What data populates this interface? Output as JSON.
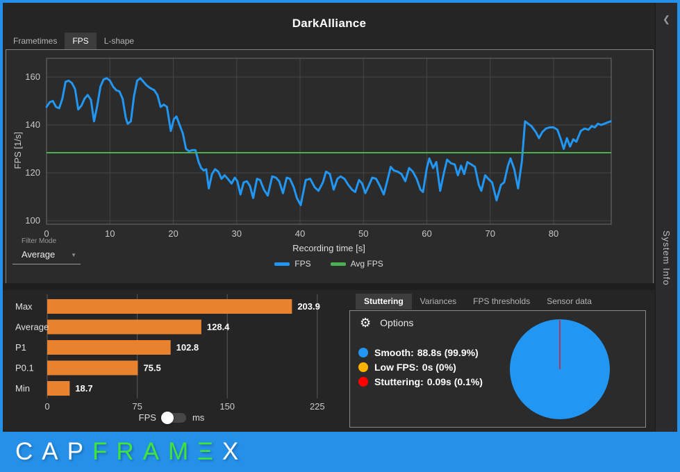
{
  "window": {
    "title": "DarkAlliance"
  },
  "icons": {
    "collapse": "❮",
    "caret": "▼",
    "gear": "⚙"
  },
  "main_tabs": [
    {
      "label": "Frametimes",
      "selected": false
    },
    {
      "label": "FPS",
      "selected": true
    },
    {
      "label": "L-shape",
      "selected": false
    }
  ],
  "sidebar": {
    "label": "System Info"
  },
  "filter": {
    "label": "Filter Mode",
    "value": "Average"
  },
  "unit_toggle": {
    "left": "FPS",
    "right": "ms"
  },
  "analysis": {
    "tabs": [
      {
        "label": "Stuttering",
        "selected": true
      },
      {
        "label": "Variances",
        "selected": false
      },
      {
        "label": "FPS thresholds",
        "selected": false
      },
      {
        "label": "Sensor data",
        "selected": false
      }
    ],
    "options_label": "Options",
    "legend": [
      {
        "label": "Smooth:",
        "value": "88.8s (99.9%)",
        "color": "#2196F3"
      },
      {
        "label": "Low FPS:",
        "value": "0s (0%)",
        "color": "#FFB300"
      },
      {
        "label": "Stuttering:",
        "value": "0.09s (0.1%)",
        "color": "#FF0000"
      }
    ]
  },
  "logo": {
    "parts": [
      {
        "text": "CAP",
        "color": "#FFFFFF"
      },
      {
        "text": "FRAMΞ",
        "color": "#3FE43F"
      },
      {
        "text": "X",
        "color": "#FFFFFF"
      }
    ]
  },
  "chart_data": [
    {
      "type": "line",
      "title": "",
      "xlabel": "Recording time [s]",
      "ylabel": "FPS [1/s]",
      "xlim": [
        0,
        89.1
      ],
      "ylim": [
        97.5,
        167.8
      ],
      "xticks": [
        0,
        10,
        20,
        30,
        40,
        50,
        60,
        70,
        80
      ],
      "yticks": [
        100,
        120,
        140,
        160
      ],
      "grid": true,
      "legend_position": "bottom",
      "series": [
        {
          "name": "FPS",
          "color": "#2196F3",
          "points": [
            [
              0,
              147.5
            ],
            [
              0.5,
              149.5
            ],
            [
              1,
              150
            ],
            [
              1.5,
              147.5
            ],
            [
              2,
              147
            ],
            [
              2.5,
              151
            ],
            [
              3,
              158
            ],
            [
              3.5,
              158.5
            ],
            [
              4,
              157.5
            ],
            [
              4.5,
              155
            ],
            [
              5,
              146.5
            ],
            [
              5.5,
              148
            ],
            [
              6,
              151
            ],
            [
              6.5,
              152.5
            ],
            [
              7,
              150.5
            ],
            [
              7.5,
              141.5
            ],
            [
              8,
              148
            ],
            [
              8.5,
              156
            ],
            [
              9,
              159
            ],
            [
              9.5,
              159.5
            ],
            [
              10,
              158.5
            ],
            [
              10.5,
              156
            ],
            [
              11,
              154.5
            ],
            [
              11.5,
              154
            ],
            [
              12,
              151
            ],
            [
              12.5,
              143
            ],
            [
              12.8,
              140.5
            ],
            [
              13.3,
              141.5
            ],
            [
              13.8,
              152
            ],
            [
              14.3,
              158.5
            ],
            [
              14.8,
              159.5
            ],
            [
              15.3,
              158
            ],
            [
              15.8,
              156.5
            ],
            [
              16.3,
              155.5
            ],
            [
              17,
              154.5
            ],
            [
              17.5,
              152.5
            ],
            [
              18,
              147.5
            ],
            [
              18.5,
              148.5
            ],
            [
              19,
              147.5
            ],
            [
              19.6,
              137.5
            ],
            [
              20.1,
              142.5
            ],
            [
              20.5,
              143.5
            ],
            [
              21,
              140
            ],
            [
              21.5,
              136.5
            ],
            [
              22,
              130
            ],
            [
              22.5,
              129
            ],
            [
              23,
              129.5
            ],
            [
              23.5,
              129.5
            ],
            [
              24,
              124.5
            ],
            [
              24.4,
              122
            ],
            [
              24.8,
              121
            ],
            [
              25.2,
              121.5
            ],
            [
              25.6,
              113.5
            ],
            [
              26.1,
              119.5
            ],
            [
              26.6,
              121.5
            ],
            [
              27.1,
              120.5
            ],
            [
              27.6,
              117.5
            ],
            [
              28.1,
              119
            ],
            [
              28.6,
              117.5
            ],
            [
              29.2,
              115.5
            ],
            [
              29.7,
              118
            ],
            [
              30.1,
              116.5
            ],
            [
              30.6,
              111
            ],
            [
              31.1,
              116
            ],
            [
              31.6,
              116.5
            ],
            [
              32.1,
              114.5
            ],
            [
              32.6,
              109.5
            ],
            [
              33.2,
              117.5
            ],
            [
              33.7,
              117
            ],
            [
              34.3,
              113
            ],
            [
              34.9,
              110.5
            ],
            [
              35.6,
              118.5
            ],
            [
              36.2,
              118
            ],
            [
              36.7,
              116.5
            ],
            [
              37.3,
              111.5
            ],
            [
              37.9,
              118
            ],
            [
              38.4,
              117.5
            ],
            [
              39,
              114
            ],
            [
              39.5,
              109.5
            ],
            [
              40.1,
              106.5
            ],
            [
              40.9,
              117
            ],
            [
              41.6,
              117.5
            ],
            [
              42.3,
              114
            ],
            [
              42.9,
              112.5
            ],
            [
              43.6,
              116
            ],
            [
              44.1,
              120.5
            ],
            [
              44.7,
              119.5
            ],
            [
              45.3,
              113
            ],
            [
              45.9,
              117.5
            ],
            [
              46.4,
              118.5
            ],
            [
              47,
              117.5
            ],
            [
              47.6,
              115
            ],
            [
              48.2,
              113
            ],
            [
              48.7,
              112
            ],
            [
              49.3,
              117
            ],
            [
              49.8,
              115.5
            ],
            [
              50.3,
              111.5
            ],
            [
              50.9,
              115
            ],
            [
              51.4,
              118
            ],
            [
              52,
              117.5
            ],
            [
              52.6,
              114.5
            ],
            [
              53.2,
              111
            ],
            [
              53.8,
              117
            ],
            [
              54.3,
              122.5
            ],
            [
              54.8,
              121
            ],
            [
              55.4,
              120.5
            ],
            [
              56,
              119.5
            ],
            [
              56.6,
              116.5
            ],
            [
              57.2,
              122
            ],
            [
              57.8,
              120.5
            ],
            [
              58.4,
              117.5
            ],
            [
              59,
              113
            ],
            [
              59.4,
              112
            ],
            [
              60,
              122
            ],
            [
              60.4,
              126
            ],
            [
              61,
              122
            ],
            [
              61.5,
              124.5
            ],
            [
              62.1,
              112.5
            ],
            [
              62.7,
              120
            ],
            [
              63.2,
              125.5
            ],
            [
              63.8,
              124
            ],
            [
              64.4,
              123.5
            ],
            [
              64.9,
              119
            ],
            [
              65.4,
              123
            ],
            [
              65.9,
              119.5
            ],
            [
              66.4,
              124.5
            ],
            [
              67,
              123.5
            ],
            [
              67.6,
              122.5
            ],
            [
              68.2,
              115
            ],
            [
              68.6,
              112.5
            ],
            [
              69.2,
              119
            ],
            [
              69.7,
              117.5
            ],
            [
              70.3,
              116
            ],
            [
              71,
              108.5
            ],
            [
              71.7,
              115
            ],
            [
              72.2,
              116
            ],
            [
              72.8,
              123
            ],
            [
              73.2,
              126
            ],
            [
              73.8,
              121.5
            ],
            [
              74.4,
              113.5
            ],
            [
              75,
              125
            ],
            [
              75.5,
              141.5
            ],
            [
              76,
              140.5
            ],
            [
              76.5,
              139.5
            ],
            [
              77.2,
              137
            ],
            [
              77.7,
              134.5
            ],
            [
              78.2,
              137
            ],
            [
              78.8,
              138.5
            ],
            [
              79.4,
              139
            ],
            [
              80,
              139
            ],
            [
              80.6,
              138
            ],
            [
              81.2,
              133.5
            ],
            [
              81.6,
              130
            ],
            [
              82.1,
              134.5
            ],
            [
              82.6,
              131
            ],
            [
              83.1,
              134
            ],
            [
              83.6,
              133
            ],
            [
              84.3,
              137.5
            ],
            [
              84.9,
              138.5
            ],
            [
              85.5,
              138
            ],
            [
              86,
              139.5
            ],
            [
              86.5,
              139
            ],
            [
              87,
              140.5
            ],
            [
              87.5,
              140
            ],
            [
              88,
              140.5
            ],
            [
              88.5,
              141
            ],
            [
              89,
              141.5
            ]
          ]
        },
        {
          "name": "Avg FPS",
          "color": "#4CAF50",
          "type": "hline",
          "value": 128.4
        }
      ]
    },
    {
      "type": "bar",
      "orientation": "horizontal",
      "categories": [
        "Max",
        "Average",
        "P1",
        "P0.1",
        "Min"
      ],
      "values": [
        203.9,
        128.4,
        102.8,
        75.5,
        18.7
      ],
      "value_labels": [
        "203.9",
        "128.4",
        "102.8",
        "75.5",
        "18.7"
      ],
      "xticks": [
        0,
        75,
        150,
        225
      ],
      "xlim": [
        0,
        225
      ],
      "bar_color": "#E8822E",
      "unit": "FPS"
    },
    {
      "type": "pie",
      "labels": [
        "Smooth",
        "Low FPS",
        "Stuttering"
      ],
      "values": [
        99.9,
        0,
        0.1
      ],
      "colors": [
        "#2196F3",
        "#FFB300",
        "#FF0000"
      ]
    }
  ]
}
